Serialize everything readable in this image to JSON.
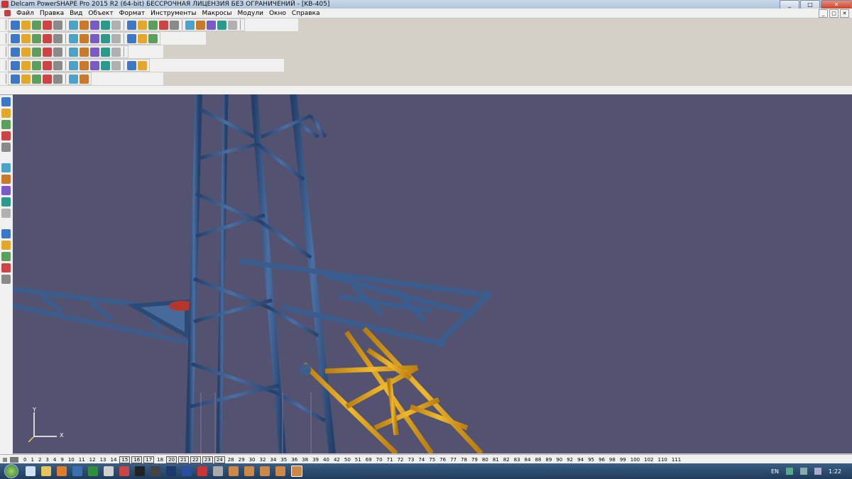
{
  "window": {
    "title": "Delcam PowerSHAPE Pro 2015 R2 (64-bit) БЕССРОЧНАЯ ЛИЦЕНЗИЯ БЕЗ ОГРАНИЧЕНИЙ - [KB-405]",
    "controls": [
      "_",
      "□",
      "✕"
    ]
  },
  "menubar": {
    "items": [
      "Файл",
      "Правка",
      "Вид",
      "Объект",
      "Формат",
      "Инструменты",
      "Макросы",
      "Модули",
      "Окно",
      "Справка"
    ],
    "mdi_controls": [
      "_",
      "□",
      "✕"
    ]
  },
  "toolbars": {
    "row1_icons": [
      "new-icon",
      "open-icon",
      "save-icon",
      "print-icon",
      "cut-icon",
      "copy-icon",
      "paste-icon",
      "delete-icon",
      "undo-icon",
      "redo-icon",
      "select-icon",
      "line-icon",
      "arc-icon",
      "circle-icon",
      "curve-icon",
      "text-icon",
      "dimension-icon",
      "measure-icon",
      "gear-icon",
      "tool-icon"
    ],
    "row2_icons": [
      "view-front-icon",
      "view-side-icon",
      "view-top-icon",
      "view-iso-icon",
      "zoom-in-icon",
      "zoom-out-icon",
      "zoom-box-icon",
      "zoom-fit-icon",
      "pan-icon",
      "rotate-icon",
      "shade-icon",
      "wireframe-icon",
      "light-icon"
    ],
    "row3_icons": [
      "layer-icon",
      "level-icon",
      "workplane-icon",
      "surface-icon",
      "solid-icon",
      "mesh-icon",
      "material-icon",
      "render-icon",
      "analyze-icon",
      "export-icon"
    ],
    "row4_icons": [
      "sketch-icon",
      "fillet-icon",
      "extrude-icon",
      "revolve-icon",
      "sweep-icon",
      "loft-icon",
      "shell-icon",
      "boolean-icon",
      "mirror-icon",
      "pattern-icon",
      "feature-icon",
      "check-icon"
    ],
    "row5_icons": [
      "assembly-icon",
      "component-icon",
      "constraint-icon",
      "motion-icon",
      "explode-icon",
      "bom-icon",
      "draft-icon"
    ]
  },
  "left_toolbar": {
    "icons": [
      "pointer-icon",
      "filter-icon",
      "workplane-icon",
      "warning-icon",
      "blend-icon",
      "trim-icon",
      "offset-icon",
      "split-icon",
      "fillet-icon",
      "transform-icon",
      "mirror-icon",
      "scale-icon",
      "surface-edit-icon",
      "solid-edit-icon",
      "mesh-edit-icon"
    ]
  },
  "viewport": {
    "background": "#535270",
    "axis": {
      "x": "X",
      "y": "Y"
    },
    "colors": {
      "tower": "#2f4e7a",
      "boom": "#d89b1c",
      "highlight": "#c0392b"
    }
  },
  "levels": {
    "items": [
      "0",
      "1",
      "2",
      "3",
      "4",
      "9",
      "10",
      "11",
      "12",
      "13",
      "14",
      "15",
      "16",
      "17",
      "18",
      "20",
      "21",
      "22",
      "23",
      "24",
      "28",
      "29",
      "30",
      "32",
      "34",
      "35",
      "36",
      "38",
      "39",
      "40",
      "42",
      "50",
      "51",
      "69",
      "70",
      "71",
      "72",
      "73",
      "74",
      "75",
      "76",
      "77",
      "78",
      "79",
      "80",
      "81",
      "82",
      "83",
      "84",
      "88",
      "89",
      "90",
      "92",
      "94",
      "95",
      "96",
      "98",
      "99",
      "100",
      "102",
      "110",
      "111"
    ],
    "boxed": [
      "15",
      "16",
      "17",
      "20",
      "21",
      "22",
      "23",
      "24"
    ]
  },
  "taskbar": {
    "language": "EN",
    "time": "1:22"
  }
}
